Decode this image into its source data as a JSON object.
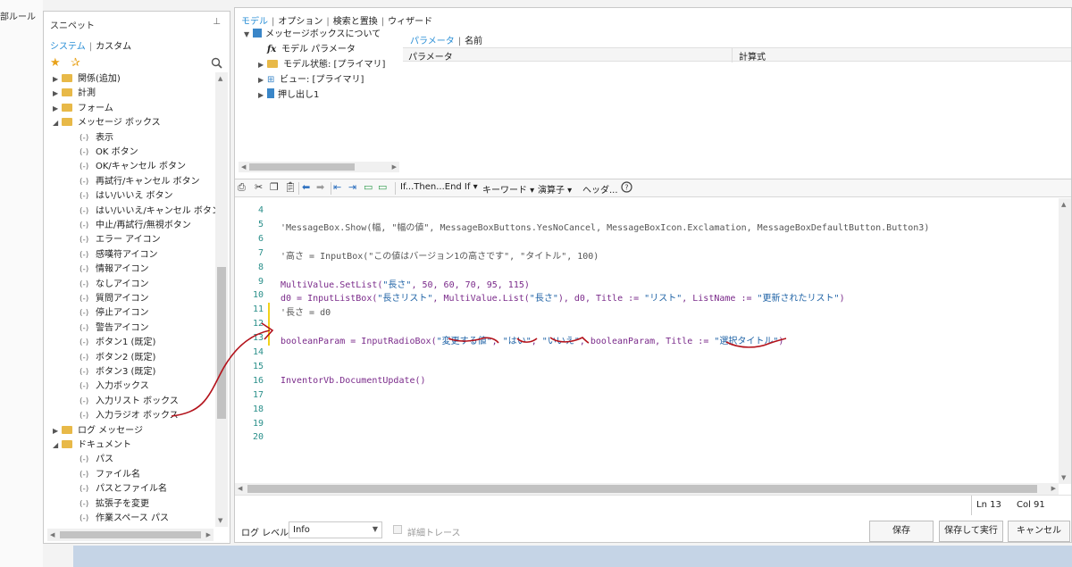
{
  "left_strip": {
    "label": "部ルール"
  },
  "snippets": {
    "title": "スニペット",
    "tabs": [
      "システム",
      "カスタム"
    ],
    "items": [
      {
        "label": "関係(追加)",
        "kind": "folder",
        "expanded": false,
        "level": 0
      },
      {
        "label": "計測",
        "kind": "folder",
        "expanded": false,
        "level": 0
      },
      {
        "label": "フォーム",
        "kind": "folder",
        "expanded": false,
        "level": 0
      },
      {
        "label": "メッセージ ボックス",
        "kind": "folder",
        "expanded": true,
        "level": 0
      },
      {
        "label": "表示",
        "kind": "snippet",
        "level": 1
      },
      {
        "label": "OK ボタン",
        "kind": "snippet",
        "level": 1
      },
      {
        "label": "OK/キャンセル ボタン",
        "kind": "snippet",
        "level": 1
      },
      {
        "label": "再試行/キャンセル ボタン",
        "kind": "snippet",
        "level": 1
      },
      {
        "label": "はい/いいえ ボタン",
        "kind": "snippet",
        "level": 1
      },
      {
        "label": "はい/いいえ/キャンセル ボタン",
        "kind": "snippet",
        "level": 1
      },
      {
        "label": "中止/再試行/無視ボタン",
        "kind": "snippet",
        "level": 1
      },
      {
        "label": "エラー アイコン",
        "kind": "snippet",
        "level": 1
      },
      {
        "label": "感嘆符アイコン",
        "kind": "snippet",
        "level": 1
      },
      {
        "label": "情報アイコン",
        "kind": "snippet",
        "level": 1
      },
      {
        "label": "なしアイコン",
        "kind": "snippet",
        "level": 1
      },
      {
        "label": "質問アイコン",
        "kind": "snippet",
        "level": 1
      },
      {
        "label": "停止アイコン",
        "kind": "snippet",
        "level": 1
      },
      {
        "label": "警告アイコン",
        "kind": "snippet",
        "level": 1
      },
      {
        "label": "ボタン1 (既定)",
        "kind": "snippet",
        "level": 1
      },
      {
        "label": "ボタン2 (既定)",
        "kind": "snippet",
        "level": 1
      },
      {
        "label": "ボタン3 (既定)",
        "kind": "snippet",
        "level": 1
      },
      {
        "label": "入力ボックス",
        "kind": "snippet",
        "level": 1
      },
      {
        "label": "入力リスト ボックス",
        "kind": "snippet",
        "level": 1
      },
      {
        "label": "入力ラジオ ボックス",
        "kind": "snippet",
        "level": 1
      },
      {
        "label": "ログ メッセージ",
        "kind": "folder",
        "expanded": false,
        "level": 0
      },
      {
        "label": "ドキュメント",
        "kind": "folder",
        "expanded": true,
        "level": 0
      },
      {
        "label": "パス",
        "kind": "snippet",
        "level": 1
      },
      {
        "label": "ファイル名",
        "kind": "snippet",
        "level": 1
      },
      {
        "label": "パスとファイル名",
        "kind": "snippet",
        "level": 1
      },
      {
        "label": "拡張子を変更",
        "kind": "snippet",
        "level": 1
      },
      {
        "label": "作業スペース パス",
        "kind": "snippet",
        "level": 1
      }
    ]
  },
  "top_tabs": [
    "モデル",
    "オプション",
    "検索と置換",
    "ウィザード"
  ],
  "model_tree": [
    {
      "label": "メッセージボックスについて",
      "icon": "part-icon",
      "arrow": "▼",
      "level": 0
    },
    {
      "label": "モデル パラメータ",
      "icon": "fx-icon",
      "arrow": "",
      "level": 1
    },
    {
      "label": "モデル状態: [プライマリ]",
      "icon": "folder-icon",
      "arrow": "▶",
      "level": 1
    },
    {
      "label": "ビュー: [プライマリ]",
      "icon": "view-icon",
      "arrow": "▶",
      "level": 1
    },
    {
      "label": "押し出し1",
      "icon": "extrude-icon",
      "arrow": "▶",
      "level": 1
    }
  ],
  "param_tabs": [
    "パラメータ",
    "名前"
  ],
  "param_columns": [
    "パラメータ",
    "計算式"
  ],
  "toolbar": {
    "if_then": "If...Then...End If",
    "keyword": "キーワード",
    "operator": "演算子",
    "header": "ヘッダ..."
  },
  "code_lines": [
    {
      "n": "4",
      "text": ""
    },
    {
      "n": "5",
      "text": "'MessageBox.Show(幅, \"幅の値\", MessageBoxButtons.YesNoCancel, MessageBoxIcon.Exclamation, MessageBoxDefaultButton.Button3)"
    },
    {
      "n": "6",
      "text": ""
    },
    {
      "n": "7",
      "text": "'高さ = InputBox(\"この値はバージョン1の高さです\", \"タイトル\", 100)"
    },
    {
      "n": "8",
      "text": ""
    },
    {
      "n": "9",
      "text": "MultiValue.SetList(\"長さ\", 50, 60, 70, 95, 115)"
    },
    {
      "n": "10",
      "text": "d0 = InputListBox(\"長さリスト\", MultiValue.List(\"長さ\"), d0, Title := \"リスト\", ListName := \"更新されたリスト\")"
    },
    {
      "n": "11",
      "text": "'長さ = d0"
    },
    {
      "n": "12",
      "text": ""
    },
    {
      "n": "13",
      "text": "booleanParam = InputRadioBox(\"変更する値\", \"はい\", \"いいえ\", booleanParam, Title := \"選択タイトル\")"
    },
    {
      "n": "14",
      "text": ""
    },
    {
      "n": "15",
      "text": ""
    },
    {
      "n": "16",
      "text": "InventorVb.DocumentUpdate()"
    },
    {
      "n": "17",
      "text": ""
    },
    {
      "n": "18",
      "text": ""
    },
    {
      "n": "19",
      "text": ""
    },
    {
      "n": "20",
      "text": ""
    }
  ],
  "status": {
    "line": "Ln 13",
    "col": "Col 91"
  },
  "bottom": {
    "log_level_label": "ログ レベル",
    "log_level_value": "Info",
    "trace_label": "詳細トレース",
    "save": "保存",
    "save_run": "保存して実行",
    "cancel": "キャンセル"
  },
  "colors": {
    "accent": "#2b8fd6",
    "annotation": "#b3121b",
    "line_number": "#2a8f8a",
    "string": "#1f63a6",
    "identifier": "#7a2a8a"
  }
}
